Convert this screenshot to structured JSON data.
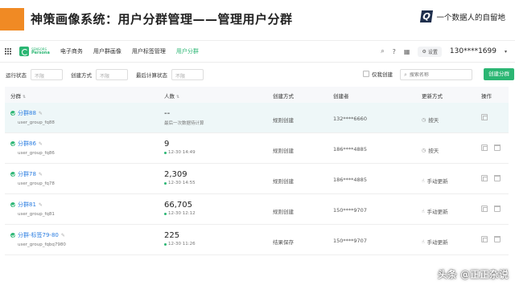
{
  "slide": {
    "title": "神策画像系统：用户分群管理——管理用户分群",
    "brand_text": "一个数据人的自留地",
    "brand_mark": "Q",
    "accent_color": "#f08a24"
  },
  "topnav": {
    "logo_top": "SENSORS",
    "logo_bottom": "Persona",
    "items": [
      {
        "label": "电子商务",
        "active": false
      },
      {
        "label": "用户群画像",
        "active": false
      },
      {
        "label": "用户标签管理",
        "active": false
      },
      {
        "label": "用户分群",
        "active": true
      }
    ],
    "settings_label": "设置",
    "user_phone": "130****1699",
    "accent_color": "#2bb673"
  },
  "filters": {
    "run_status_label": "运行状态",
    "run_status_value": "不限",
    "create_method_label": "创建方式",
    "create_method_value": "不限",
    "last_calc_label": "最后计算状态",
    "last_calc_value": "不限",
    "only_mine_label": "仅我创建",
    "search_placeholder": "搜索名称",
    "create_button": "创建分群"
  },
  "table": {
    "headers": {
      "segment": "分群",
      "count": "人数",
      "method": "创建方式",
      "creator": "创建者",
      "update": "更新方式",
      "ops": "操作"
    },
    "rows": [
      {
        "name": "分群88",
        "code": "user_group_fq88",
        "count": "--",
        "count_sub": "最后一次数据待计算",
        "method": "规则创建",
        "creator": "132****6660",
        "update": "按天",
        "update_icon": "clock-icon"
      },
      {
        "name": "分群86",
        "code": "user_group_fq86",
        "count": "9",
        "count_sub": "12-30 14:49",
        "method": "规则创建",
        "creator": "186****4885",
        "update": "按天",
        "update_icon": "clock-icon"
      },
      {
        "name": "分群78",
        "code": "user_group_fq78",
        "count": "2,309",
        "count_sub": "12-30 14:55",
        "method": "规则创建",
        "creator": "186****4885",
        "update": "手动更新",
        "update_icon": "hand-icon"
      },
      {
        "name": "分群81",
        "code": "user_group_fq81",
        "count": "66,705",
        "count_sub": "12-30 12:12",
        "method": "规则创建",
        "creator": "150****9707",
        "update": "手动更新",
        "update_icon": "hand-icon"
      },
      {
        "name": "分群-标签79-80",
        "code": "user_group_fqbq7980",
        "count": "225",
        "count_sub": "12-30 11:26",
        "method": "结果保存",
        "creator": "150****9707",
        "update": "手动更新",
        "update_icon": "hand-icon"
      }
    ]
  },
  "watermark": "头条 @正正杂说"
}
